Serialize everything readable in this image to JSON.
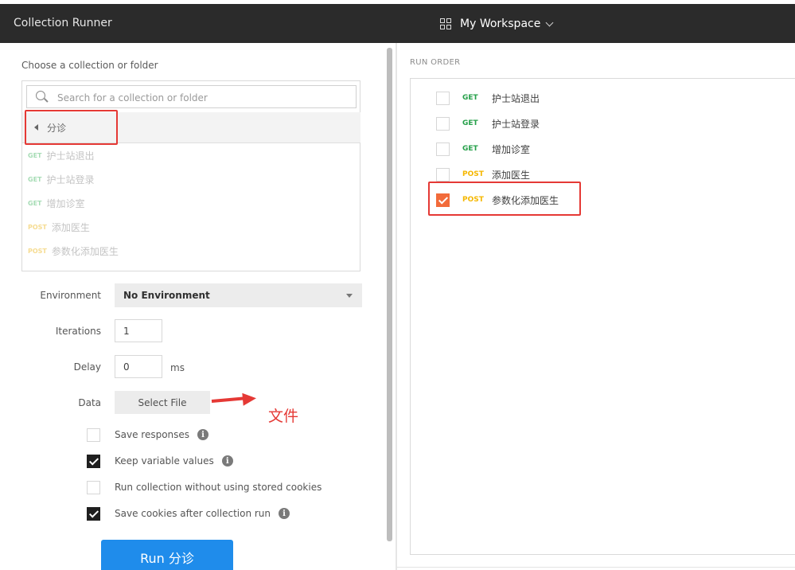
{
  "app": {
    "title": "Collection Runner",
    "workspace": "My Workspace"
  },
  "left": {
    "choose_label": "Choose a collection or folder",
    "search_placeholder": "Search for a collection or folder",
    "folder": "分诊",
    "requests": [
      {
        "method": "GET",
        "name": "护士站退出"
      },
      {
        "method": "GET",
        "name": "护士站登录"
      },
      {
        "method": "GET",
        "name": "增加诊室"
      },
      {
        "method": "POST",
        "name": "添加医生"
      },
      {
        "method": "POST",
        "name": "参数化添加医生"
      }
    ],
    "environment_label": "Environment",
    "environment_value": "No Environment",
    "iterations_label": "Iterations",
    "iterations_value": "1",
    "delay_label": "Delay",
    "delay_value": "0",
    "delay_unit": "ms",
    "data_label": "Data",
    "select_file": "Select File",
    "annotation": "文件",
    "options": [
      {
        "label": "Save responses",
        "checked": false,
        "info": true
      },
      {
        "label": "Keep variable values",
        "checked": true,
        "info": true
      },
      {
        "label": "Run collection without using stored cookies",
        "checked": false,
        "info": false
      },
      {
        "label": "Save cookies after collection run",
        "checked": true,
        "info": true
      }
    ],
    "run_button": "Run 分诊"
  },
  "right": {
    "header": "RUN ORDER",
    "items": [
      {
        "method": "GET",
        "name": "护士站退出",
        "checked": false
      },
      {
        "method": "GET",
        "name": "护士站登录",
        "checked": false
      },
      {
        "method": "GET",
        "name": "增加诊室",
        "checked": false
      },
      {
        "method": "POST",
        "name": "添加医生",
        "checked": false
      },
      {
        "method": "POST",
        "name": "参数化添加医生",
        "checked": true
      }
    ]
  },
  "colors": {
    "header_bg": "#2b2b2b",
    "accent": "#1f8ceb",
    "get": "#26a04a",
    "post": "#f5b700",
    "annotation_red": "#e53935",
    "checked_orange": "#f26b3a"
  }
}
